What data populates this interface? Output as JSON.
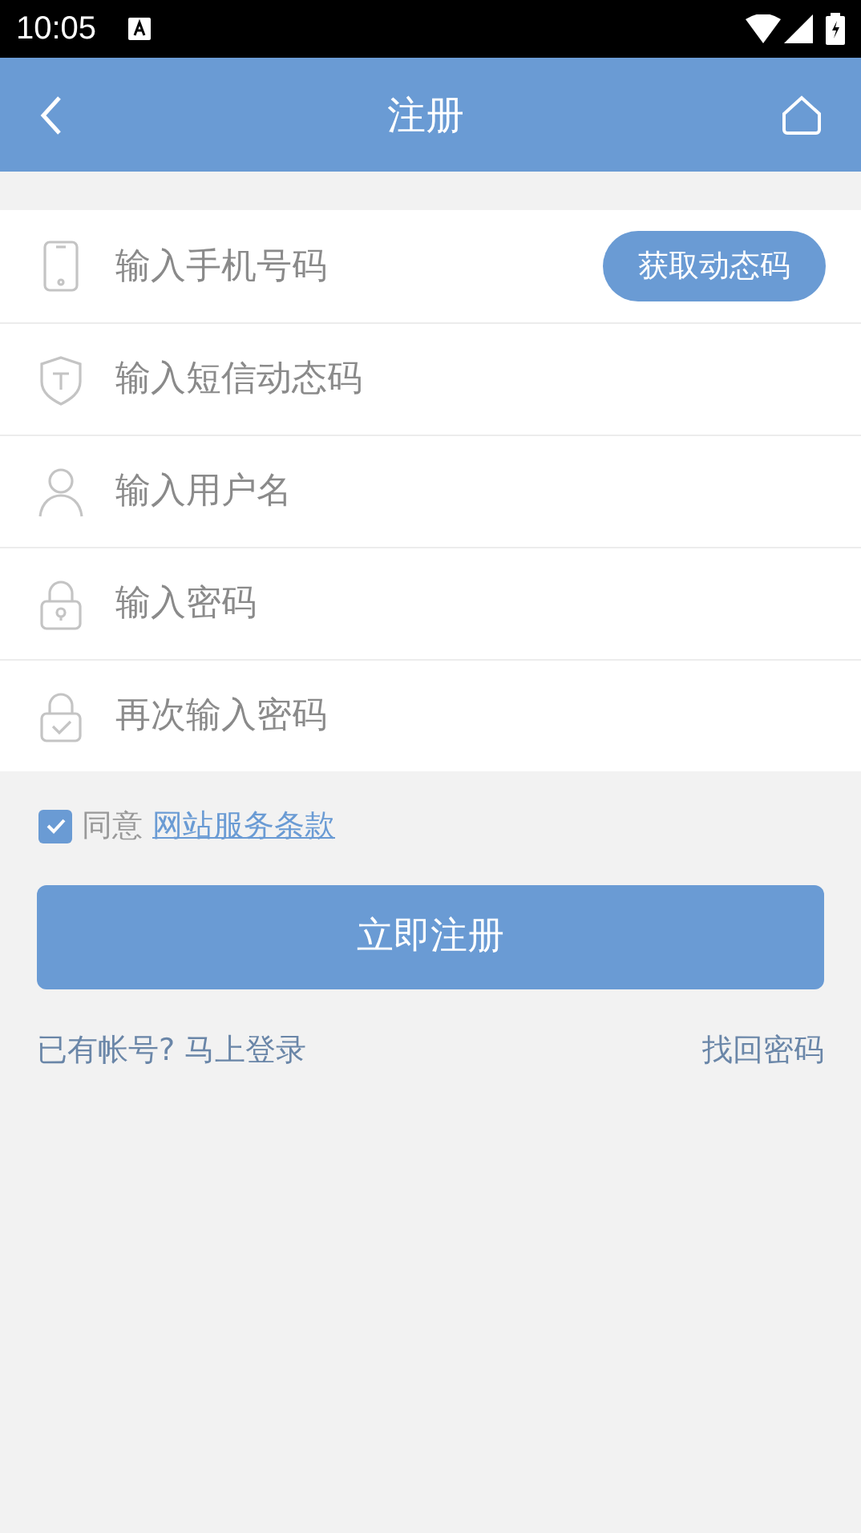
{
  "status_bar": {
    "time": "10:05"
  },
  "header": {
    "title": "注册"
  },
  "fields": [
    {
      "kind": "phone",
      "placeholder": "输入手机号码",
      "button": "获取动态码"
    },
    {
      "kind": "shield",
      "placeholder": "输入短信动态码"
    },
    {
      "kind": "user",
      "placeholder": "输入用户名"
    },
    {
      "kind": "lock",
      "placeholder": "输入密码"
    },
    {
      "kind": "lock-check",
      "placeholder": "再次输入密码"
    }
  ],
  "agreement": {
    "checked": true,
    "label": "同意",
    "link": "网站服务条款"
  },
  "submit": "立即注册",
  "links": {
    "login": "已有帐号? 马上登录",
    "recover": "找回密码"
  }
}
